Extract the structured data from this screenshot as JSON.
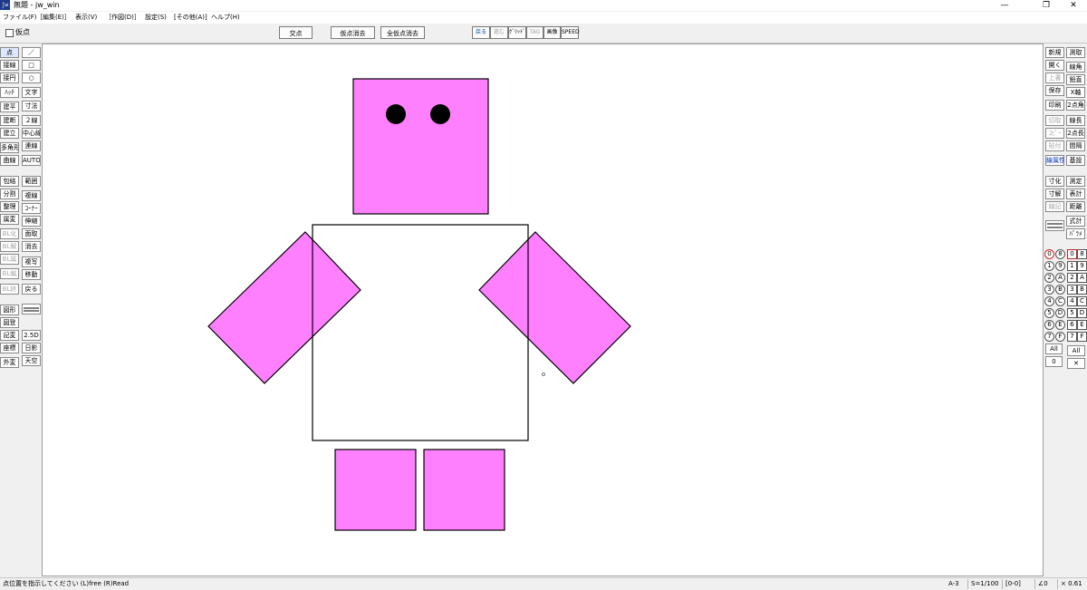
{
  "window": {
    "title": "無題 - jw_win",
    "app_icon": "jw",
    "minimize": "—",
    "maximize": "❐",
    "close": "✕"
  },
  "menu": [
    "ファイル(F)",
    "［編集(E)］",
    "表示(V)",
    "［作図(D)］",
    "設定(S)",
    "[その他(A)]",
    "ヘルプ(H)"
  ],
  "toolbar": {
    "checkbox_label": "仮点",
    "btn_intersection": "交点",
    "btn_erase_temp": "仮点消去",
    "btn_erase_all_temp": "全仮点消去",
    "std_buttons": [
      "戻る",
      "進む",
      "ｸﾞﾘｯﾄﾞ",
      "TAG",
      "画像",
      "SPEED"
    ]
  },
  "left_tools": {
    "col1": [
      "点",
      "接線",
      "接円",
      "ﾊｯﾁ",
      "建平",
      "建断",
      "建立",
      "多角形",
      "曲線",
      "包絡",
      "分割",
      "整理",
      "属変",
      "BL化",
      "BL解",
      "BL属",
      "BL編",
      "BL終",
      "図形",
      "図登",
      "記変",
      "座標",
      "外変"
    ],
    "col2": [
      "／",
      "□",
      "○",
      "文字",
      "寸法",
      "２線",
      "中心線",
      "連線",
      "AUTO",
      "範囲",
      "複線",
      "ｺｰﾅｰ",
      "伸縮",
      "面取",
      "消去",
      "複写",
      "移動",
      "戻る",
      "2.5D",
      "日影",
      "天空"
    ]
  },
  "right_tools": {
    "col1": [
      "新規",
      "開く",
      "上書",
      "保存",
      "印刷",
      "切取",
      "ｺﾋﾟｰ",
      "貼付",
      "線属性",
      "寸化",
      "寸解",
      "線記",
      "式計"
    ],
    "col2": [
      "測取",
      "線角",
      "鉛直",
      "X軸",
      "2点角",
      "線長",
      "2点長",
      "間隔",
      "基設",
      "測定",
      "表計",
      "距離",
      "ﾊﾟﾗﾒ"
    ]
  },
  "layers": {
    "left": [
      "0",
      "1",
      "2",
      "3",
      "4",
      "5",
      "6",
      "7"
    ],
    "left_hex": [
      "8",
      "9",
      "A",
      "B",
      "C",
      "D",
      "E",
      "F"
    ],
    "right": [
      "0",
      "1",
      "2",
      "3",
      "4",
      "5",
      "6",
      "7"
    ],
    "right_hex": [
      "8",
      "9",
      "A",
      "B",
      "C",
      "D",
      "E",
      "F"
    ],
    "all_label": "All",
    "zero_label": "0",
    "x_label": "✕"
  },
  "status": {
    "message": "点位置を指示してください (L)free (R)Read",
    "paper": "A-3",
    "scale": "S=1/100",
    "layer": "[0-0]",
    "angle": "∠0",
    "zoom": "× 0.61"
  },
  "drawing": {
    "fill_color": "#ff80ff",
    "stroke_color": "#000000",
    "eye_color": "#000000"
  }
}
